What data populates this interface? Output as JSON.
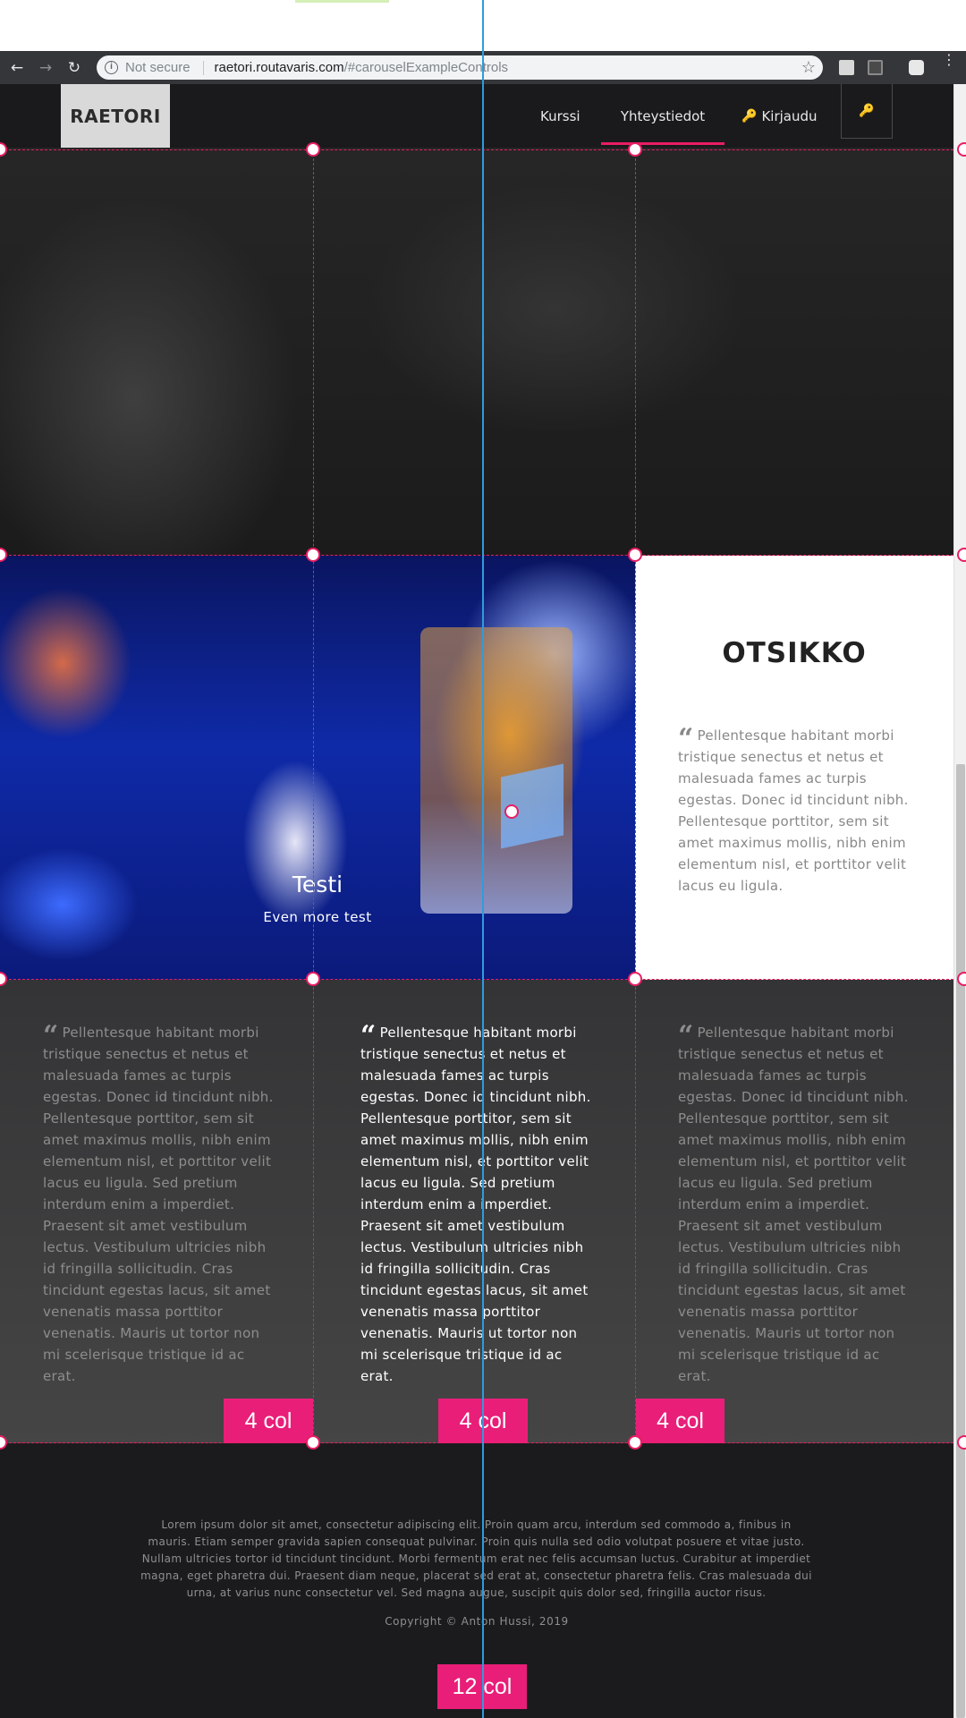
{
  "browser": {
    "not_secure": "Not secure",
    "url_host": "raetori.routavaris.com",
    "url_path": "/#carouselExampleControls",
    "icons": [
      "back-arrow-icon",
      "forward-arrow-icon",
      "reload-icon",
      "info-icon",
      "star-icon",
      "menu-dots-icon"
    ]
  },
  "nav": {
    "brand": "RAETORI",
    "items": [
      {
        "label": "Kurssi"
      },
      {
        "label": "Yhteystiedot",
        "active": true
      },
      {
        "label": "Kirjaudu",
        "icon": "key-icon"
      }
    ],
    "key_button_icon": "key-icon"
  },
  "carousel": {
    "title": "Testi",
    "subtitle": "Even more test"
  },
  "card": {
    "heading": "OTSIKKO",
    "quote": "Pellentesque habitant morbi tristique senectus et netus et malesuada fames ac turpis egestas. Donec id tincidunt nibh. Pellentesque porttitor, sem sit amet maximus mollis, nibh enim elementum nisl, et porttitor velit lacus eu ligula."
  },
  "columns": [
    {
      "text": "Pellentesque habitant morbi tristique senectus et netus et malesuada fames ac turpis egestas. Donec id tincidunt nibh. Pellentesque porttitor, sem sit amet maximus mollis, nibh enim elementum nisl, et porttitor velit lacus eu ligula. Sed pretium interdum enim a imperdiet. Praesent sit amet vestibulum lectus. Vestibulum ultricies nibh id fringilla sollicitudin. Cras tincidunt egestas lacus, sit amet venenatis massa porttitor venenatis. Mauris ut tortor non mi scelerisque tristique id ac erat.",
      "badge": "4 col"
    },
    {
      "text": "Pellentesque habitant morbi tristique senectus et netus et malesuada fames ac turpis egestas. Donec id tincidunt nibh. Pellentesque porttitor, sem sit amet maximus mollis, nibh enim elementum nisl, et porttitor velit lacus eu ligula. Sed pretium interdum enim a imperdiet. Praesent sit amet vestibulum lectus. Vestibulum ultricies nibh id fringilla sollicitudin. Cras tincidunt egestas lacus, sit amet venenatis massa porttitor venenatis. Mauris ut tortor non mi scelerisque tristique id ac erat.",
      "badge": "4 col"
    },
    {
      "text": "Pellentesque habitant morbi tristique senectus et netus et malesuada fames ac turpis egestas. Donec id tincidunt nibh. Pellentesque porttitor, sem sit amet maximus mollis, nibh enim elementum nisl, et porttitor velit lacus eu ligula. Sed pretium interdum enim a imperdiet. Praesent sit amet vestibulum lectus. Vestibulum ultricies nibh id fringilla sollicitudin. Cras tincidunt egestas lacus, sit amet venenatis massa porttitor venenatis. Mauris ut tortor non mi scelerisque tristique id ac erat.",
      "badge": "4 col"
    }
  ],
  "footer": {
    "text": "Lorem ipsum dolor sit amet, consectetur adipiscing elit. Proin quam arcu, interdum sed commodo a, finibus in mauris. Etiam semper gravida sapien consequat pulvinar. Proin quis nulla sed odio volutpat posuere et vitae justo. Nullam ultricies tortor id tincidunt tincidunt. Morbi fermentum erat nec felis accumsan luctus. Curabitur at imperdiet magna, eget pharetra dui. Praesent diam neque, placerat sed erat at, consectetur pharetra felis. Cras malesuada dui urna, at varius nunc consectetur vel. Sed magna augue, suscipit quis dolor sed, fringilla auctor risus.",
    "copyright": "Copyright © Anton Hussi, 2019",
    "badge": "12 col"
  },
  "colors": {
    "accent": "#e91e63",
    "badge": "#e91e79",
    "guide_line": "#2f9bde"
  }
}
